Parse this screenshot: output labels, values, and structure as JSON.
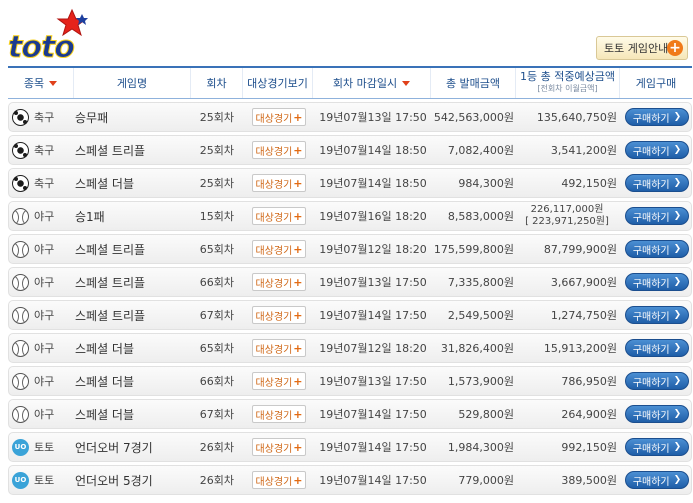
{
  "logo_text": "toto",
  "guide_button": "토토 게임안내",
  "headers": {
    "sport": "종목",
    "game": "게임명",
    "round": "회차",
    "target": "대상경기보기",
    "deadline": "회차 마감일시",
    "sales": "총 발매금액",
    "prize": "1등 총 적중예상금액",
    "prize_sub": "[전회차 이월금액]",
    "buy": "게임구매"
  },
  "target_label": "대상경기",
  "buy_label": "구매하기",
  "rows": [
    {
      "icon": "soccer",
      "sport": "축구",
      "game": "승무패",
      "round": "25회차",
      "deadline": "19년07월13일 17:50",
      "sales": "542,563,000원",
      "prize": "135,640,750원",
      "carry": ""
    },
    {
      "icon": "soccer",
      "sport": "축구",
      "game": "스페셜 트리플",
      "round": "25회차",
      "deadline": "19년07월14일 18:50",
      "sales": "7,082,400원",
      "prize": "3,541,200원",
      "carry": ""
    },
    {
      "icon": "soccer",
      "sport": "축구",
      "game": "스페셜 더블",
      "round": "25회차",
      "deadline": "19년07월14일 18:50",
      "sales": "984,300원",
      "prize": "492,150원",
      "carry": ""
    },
    {
      "icon": "baseball",
      "sport": "야구",
      "game": "승1패",
      "round": "15회차",
      "deadline": "19년07월16일 18:20",
      "sales": "8,583,000원",
      "prize": "226,117,000원",
      "carry": "[ 223,971,250원]"
    },
    {
      "icon": "baseball",
      "sport": "야구",
      "game": "스페셜 트리플",
      "round": "65회차",
      "deadline": "19년07월12일 18:20",
      "sales": "175,599,800원",
      "prize": "87,799,900원",
      "carry": ""
    },
    {
      "icon": "baseball",
      "sport": "야구",
      "game": "스페셜 트리플",
      "round": "66회차",
      "deadline": "19년07월13일 17:50",
      "sales": "7,335,800원",
      "prize": "3,667,900원",
      "carry": ""
    },
    {
      "icon": "baseball",
      "sport": "야구",
      "game": "스페셜 트리플",
      "round": "67회차",
      "deadline": "19년07월14일 17:50",
      "sales": "2,549,500원",
      "prize": "1,274,750원",
      "carry": ""
    },
    {
      "icon": "baseball",
      "sport": "야구",
      "game": "스페셜 더블",
      "round": "65회차",
      "deadline": "19년07월12일 18:20",
      "sales": "31,826,400원",
      "prize": "15,913,200원",
      "carry": ""
    },
    {
      "icon": "baseball",
      "sport": "야구",
      "game": "스페셜 더블",
      "round": "66회차",
      "deadline": "19년07월13일 17:50",
      "sales": "1,573,900원",
      "prize": "786,950원",
      "carry": ""
    },
    {
      "icon": "baseball",
      "sport": "야구",
      "game": "스페셜 더블",
      "round": "67회차",
      "deadline": "19년07월14일 17:50",
      "sales": "529,800원",
      "prize": "264,900원",
      "carry": ""
    },
    {
      "icon": "uo",
      "sport": "토토",
      "game": "언더오버 7경기",
      "round": "26회차",
      "deadline": "19년07월14일 17:50",
      "sales": "1,984,300원",
      "prize": "992,150원",
      "carry": ""
    },
    {
      "icon": "uo",
      "sport": "토토",
      "game": "언더오버 5경기",
      "round": "26회차",
      "deadline": "19년07월14일 17:50",
      "sales": "779,000원",
      "prize": "389,500원",
      "carry": ""
    }
  ],
  "colors": {
    "accent": "#1f5ea8",
    "header_text": "#1d4e8c",
    "orange": "#e26a12"
  }
}
